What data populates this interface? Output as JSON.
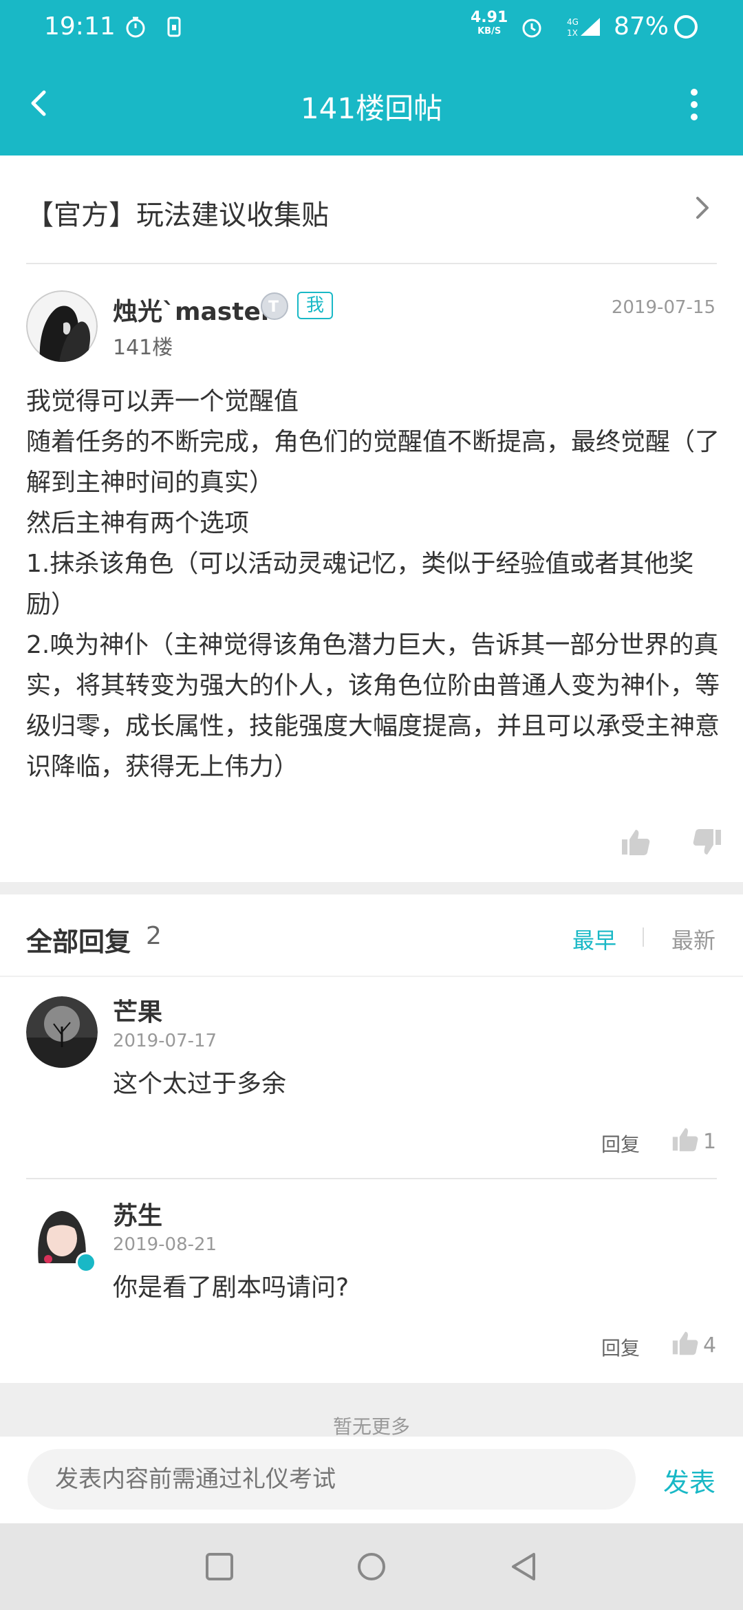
{
  "status_bar": {
    "time": "19:11",
    "net_speed": "4.91",
    "net_unit": "KB/S",
    "battery": "87%"
  },
  "header": {
    "title": "141楼回帖"
  },
  "topic": {
    "title": "【官方】玩法建议收集贴"
  },
  "post": {
    "author": "烛光`master",
    "me_badge": "我",
    "floor": "141楼",
    "date": "2019-07-15",
    "paragraphs": [
      "我觉得可以弄一个觉醒值",
      "随着任务的不断完成，角色们的觉醒值不断提高，最终觉醒（了解到主神时间的真实）",
      "然后主神有两个选项",
      "1.抹杀该角色（可以活动灵魂记忆，类似于经验值或者其他奖励）",
      "2.唤为神仆（主神觉得该角色潜力巨大，告诉其一部分世界的真实，将其转变为强大的仆人，该角色位阶由普通人变为神仆，等级归零，成长属性，技能强度大幅度提高，并且可以承受主神意识降临，获得无上伟力）"
    ]
  },
  "replies_header": {
    "title": "全部回复",
    "count": "2",
    "sort_earliest": "最早",
    "sort_latest": "最新"
  },
  "replies": [
    {
      "name": "芒果",
      "date": "2019-07-17",
      "text": "这个太过于多余",
      "reply_label": "回复",
      "likes": "1"
    },
    {
      "name": "苏生",
      "date": "2019-08-21",
      "text": "你是看了剧本吗请问?",
      "reply_label": "回复",
      "likes": "4"
    }
  ],
  "footer": {
    "no_more": "暂无更多",
    "input_placeholder": "发表内容前需通过礼仪考试",
    "publish_label": "发表"
  },
  "colors": {
    "accent": "#19b8c6"
  }
}
